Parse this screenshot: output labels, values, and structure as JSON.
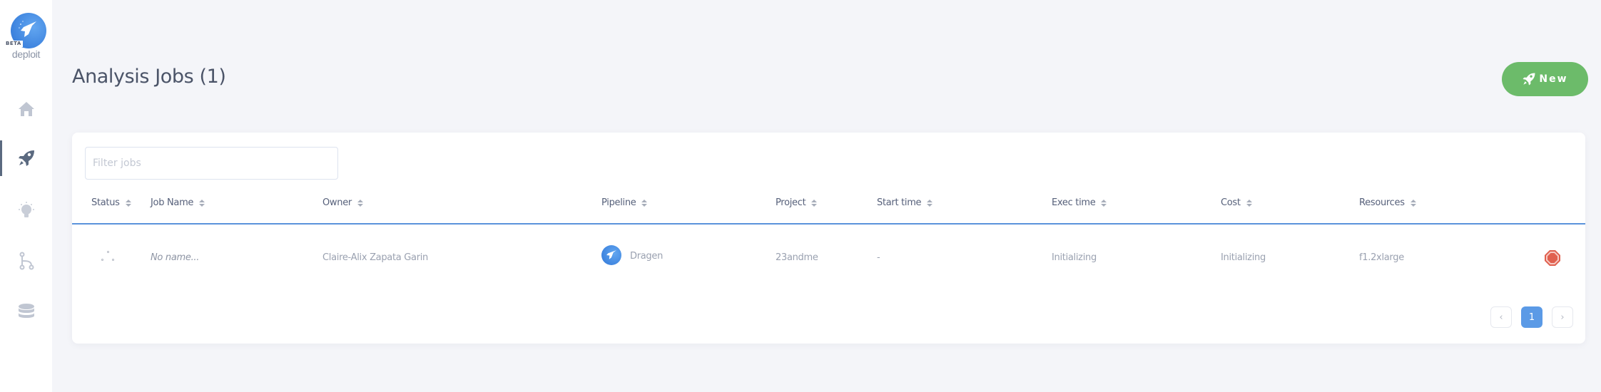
{
  "sidebar": {
    "logo": {
      "badge": "BETA",
      "name": "deploit",
      "icon": "rocket-logo-icon"
    },
    "items": [
      {
        "name": "home",
        "icon": "home-icon",
        "active": false
      },
      {
        "name": "jobs",
        "icon": "rocket-icon",
        "active": true
      },
      {
        "name": "ideas",
        "icon": "lightbulb-icon",
        "active": false
      },
      {
        "name": "pipelines",
        "icon": "branch-icon",
        "active": false
      },
      {
        "name": "data",
        "icon": "database-icon",
        "active": false
      }
    ]
  },
  "header": {
    "title": "Analysis Jobs (1)",
    "new_button": {
      "label": "New",
      "icon": "rocket-icon"
    }
  },
  "jobs": {
    "filter": {
      "placeholder": "Filter jobs",
      "value": ""
    },
    "columns": [
      "Status",
      "Job Name",
      "Owner",
      "Pipeline",
      "Project",
      "Start time",
      "Exec time",
      "Cost",
      "Resources"
    ],
    "rows": [
      {
        "status": "initializing",
        "status_icon": "spinner-icon",
        "job_name": "No name...",
        "owner": "Claire-Alix Zapata Garin",
        "pipeline": "Dragen",
        "pipeline_icon": "pipeline-logo-icon",
        "project": "23andme",
        "start_time": "-",
        "exec_time": "Initializing",
        "cost": "Initializing",
        "resources": "f1.2xlarge",
        "action_icon": "stop-icon"
      }
    ],
    "pagination": {
      "prev": "‹",
      "current": "1",
      "next": "›"
    }
  },
  "colors": {
    "accent_blue": "#5b9ae6",
    "new_button_green": "#6cbb6a",
    "stop_red": "#e0604f",
    "background": "#f4f5f9"
  }
}
